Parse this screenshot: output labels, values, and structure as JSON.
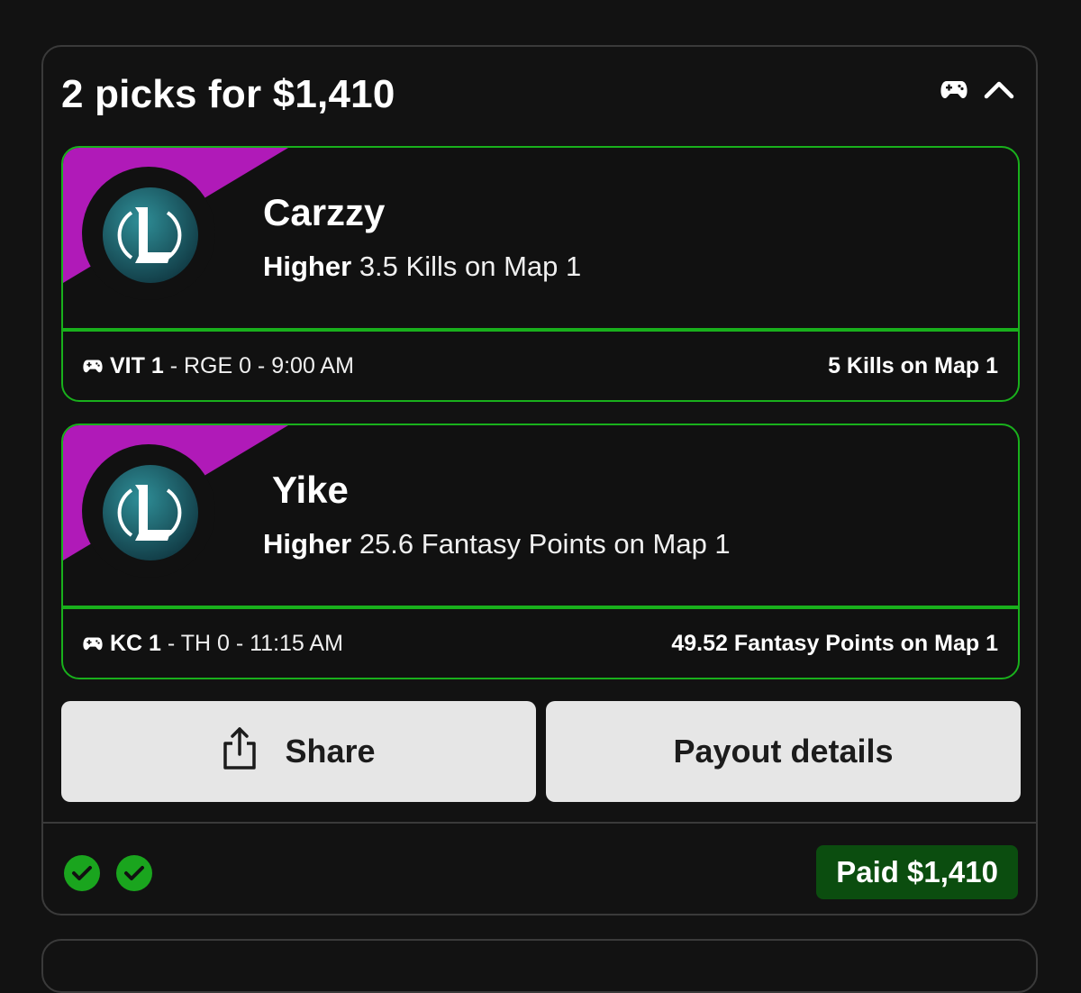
{
  "header": {
    "title": "2 picks for $1,410",
    "icons": [
      "gamepad-icon",
      "chevron-up-icon"
    ]
  },
  "picks": [
    {
      "player": "Carzzy",
      "direction": "Higher",
      "line": "3.5 Kills on Map 1",
      "match_team1": "VIT 1",
      "match_rest": " - RGE 0 - 9:00 AM",
      "result": "5 Kills on Map 1"
    },
    {
      "player": "Yike",
      "direction": "Higher",
      "line": "25.6 Fantasy Points on Map 1",
      "match_team1": "KC 1",
      "match_rest": " - TH 0 - 11:15 AM",
      "result": "49.52 Fantasy Points on Map 1"
    }
  ],
  "actions": {
    "share_label": "Share",
    "payout_label": "Payout details"
  },
  "status": {
    "paid_label": "Paid $1,410",
    "checks": [
      "check-icon",
      "check-icon"
    ]
  },
  "colors": {
    "accent_green": "#19b01c",
    "corner_magenta": "#b01ab8",
    "paid_bg": "#0b4d0f",
    "check_green": "#1aa51e"
  }
}
